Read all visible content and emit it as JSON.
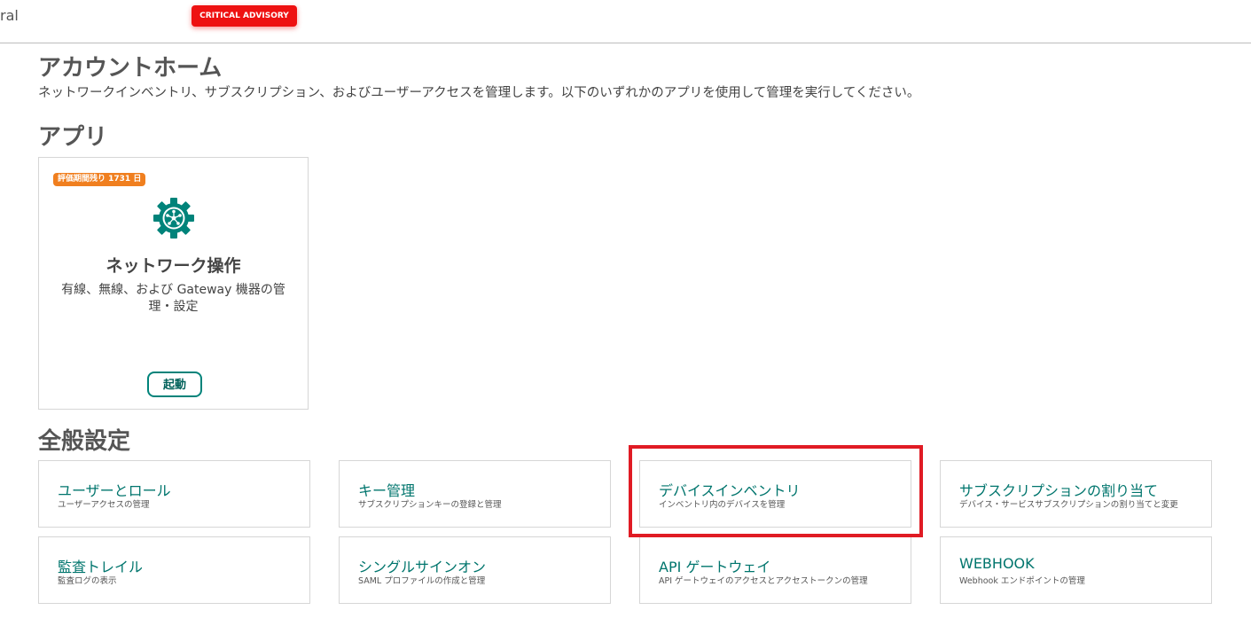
{
  "header": {
    "brand_fragment": "ral",
    "advisory_label": "CRITICAL ADVISORY"
  },
  "page": {
    "title": "アカウントホーム",
    "description": "ネットワークインベントリ、サブスクリプション、およびユーザーアクセスを管理します。以下のいずれかのアプリを使用して管理を実行してください。"
  },
  "apps": {
    "section_title": "アプリ",
    "card": {
      "badge": "評価期間残り 1731 日",
      "icon": "network-gear-icon",
      "name": "ネットワーク操作",
      "description": "有線、無線、および Gateway 機器の管理・設定",
      "launch_label": "起動"
    }
  },
  "settings": {
    "section_title": "全般設定",
    "items": [
      {
        "title": "ユーザーとロール",
        "subtitle": "ユーザーアクセスの管理"
      },
      {
        "title": "キー管理",
        "subtitle": "サブスクリプションキーの登録と管理"
      },
      {
        "title": "デバイスインベントリ",
        "subtitle": "インベントリ内のデバイスを管理"
      },
      {
        "title": "サブスクリプションの割り当て",
        "subtitle": "デバイス・サービスサブスクリプションの割り当てと変更"
      },
      {
        "title": "監査トレイル",
        "subtitle": "監査ログの表示"
      },
      {
        "title": "シングルサインオン",
        "subtitle": "SAML プロファイルの作成と管理"
      },
      {
        "title": "API ゲートウェイ",
        "subtitle": "API ゲートウェイのアクセスとアクセストークンの管理"
      },
      {
        "title": "WEBHOOK",
        "subtitle": "Webhook エンドポイントの管理"
      }
    ]
  },
  "colors": {
    "accent": "#00837a",
    "advisory": "#ee1111",
    "badge": "#f07f1f",
    "highlight": "#e01b24"
  }
}
